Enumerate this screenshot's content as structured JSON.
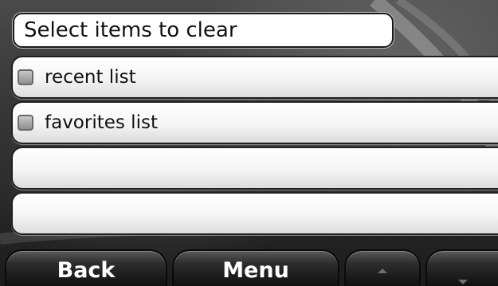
{
  "header": {
    "title": "Select items to clear"
  },
  "list": {
    "items": [
      {
        "label": "recent list",
        "checked": false
      },
      {
        "label": "favorites list",
        "checked": false
      },
      {
        "label": ""
      },
      {
        "label": ""
      }
    ]
  },
  "toolbar": {
    "back_label": "Back",
    "menu_label": "Menu",
    "up_icon": "arrow-up-icon",
    "down_icon": "arrow-down-icon"
  }
}
